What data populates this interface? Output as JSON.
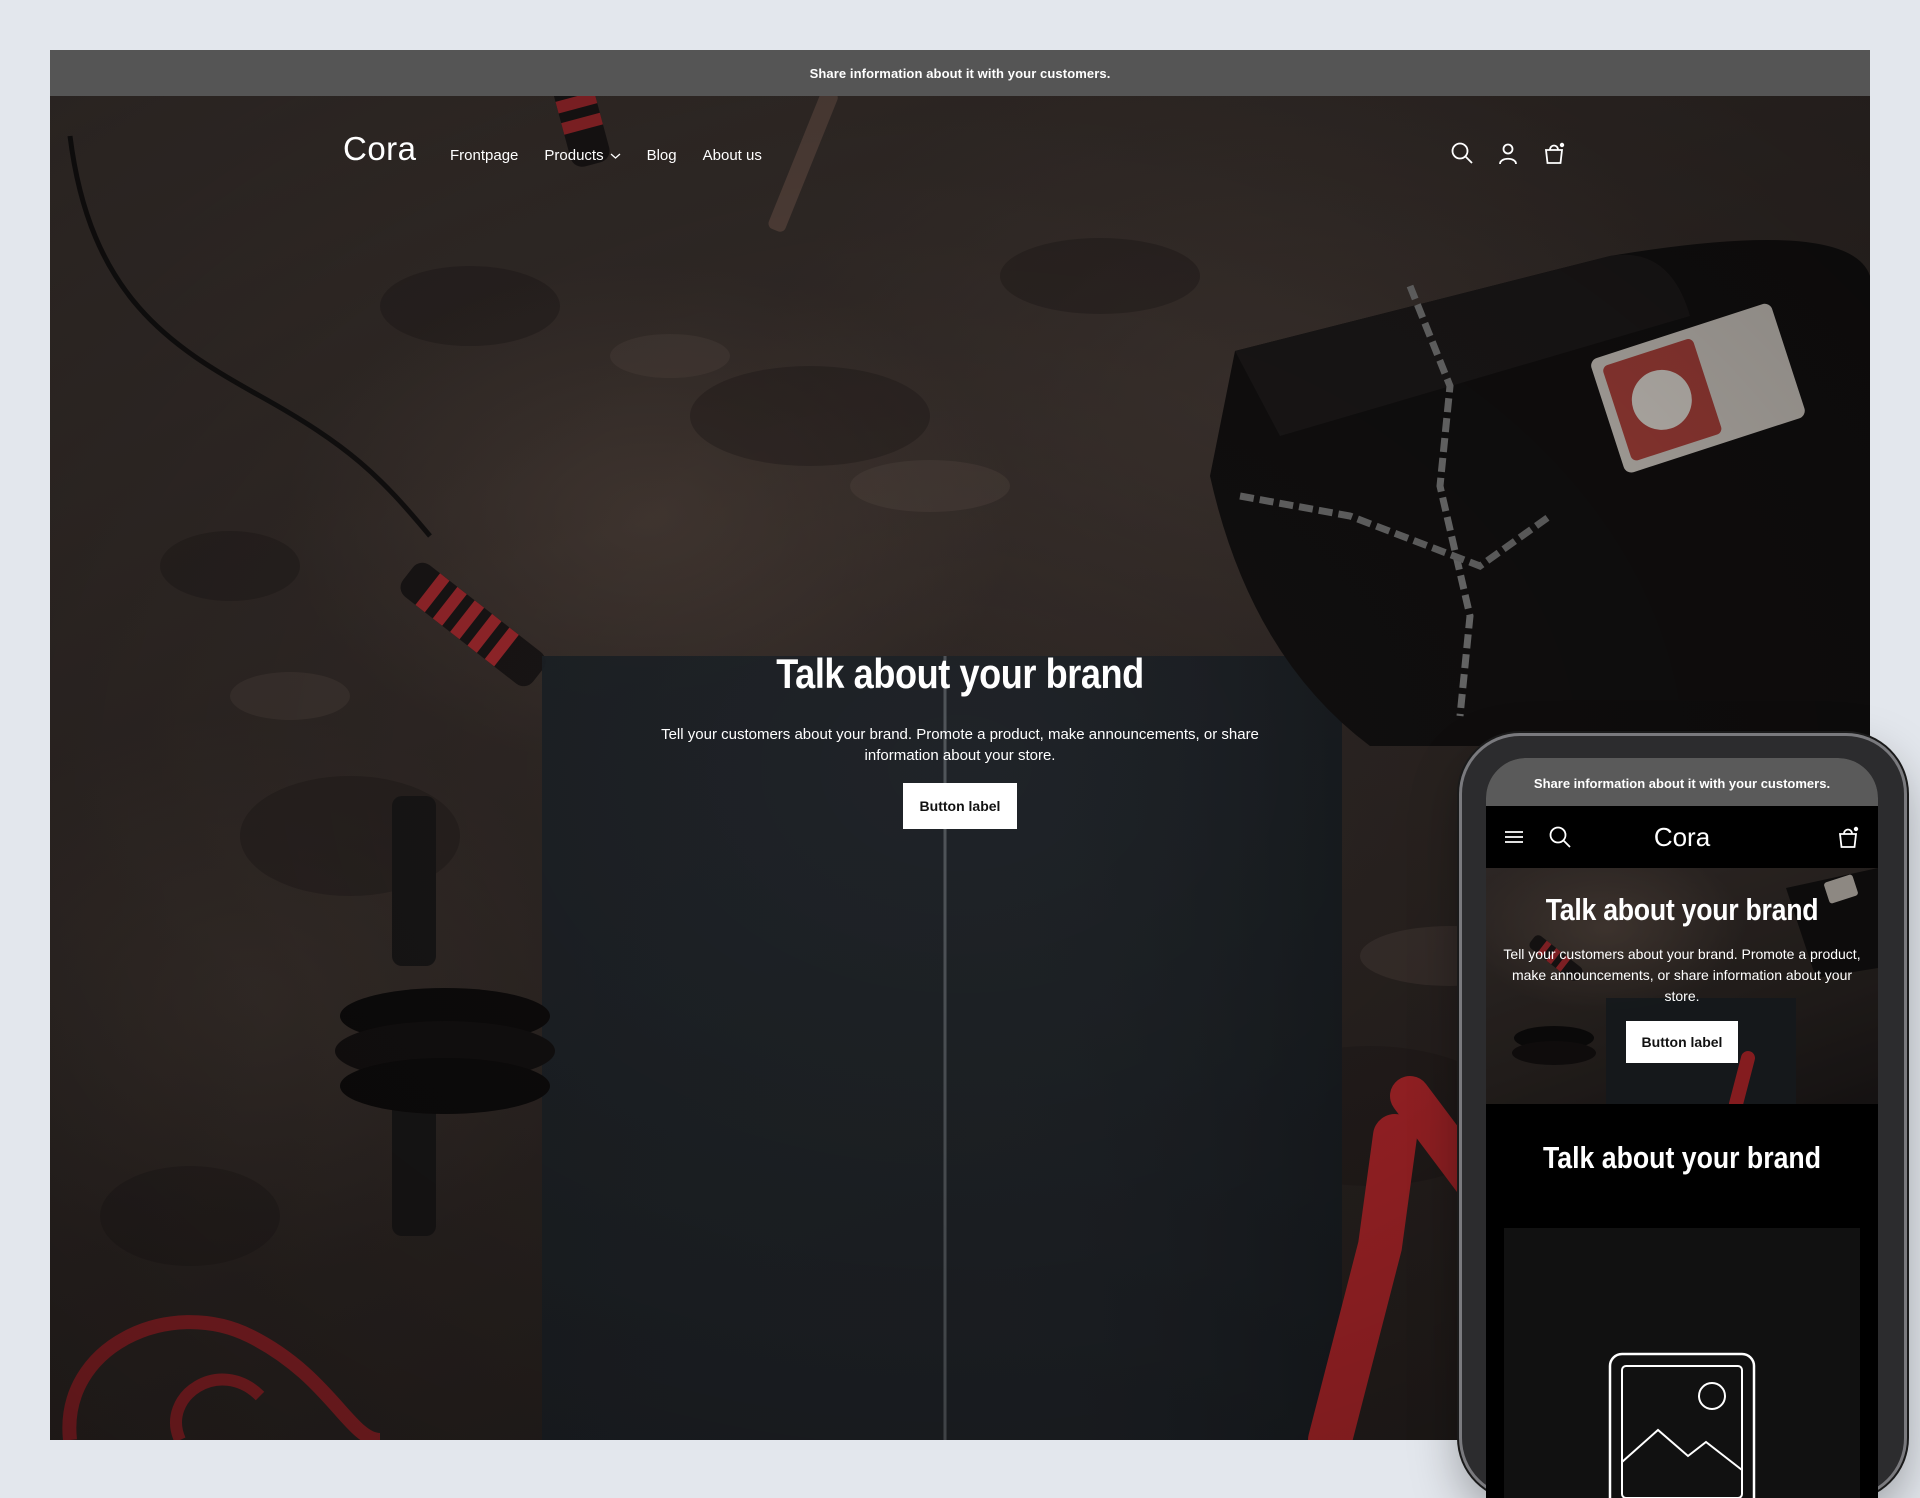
{
  "desktop": {
    "announcement": "Share information about it with your customers.",
    "logo": "Cora",
    "nav": [
      {
        "label": "Frontpage"
      },
      {
        "label": "Products"
      },
      {
        "label": "Blog"
      },
      {
        "label": "About us"
      }
    ],
    "icons": [
      "search-icon",
      "account-icon",
      "cart-icon"
    ],
    "hero": {
      "title": "Talk about your brand",
      "text": "Tell your customers about your brand. Promote a product, make announcements, or share information about your store.",
      "button": "Button label"
    }
  },
  "mobile": {
    "announcement": "Share information about it with your customers.",
    "logo": "Cora",
    "icons": [
      "menu-icon",
      "search-icon",
      "cart-icon"
    ],
    "hero": {
      "title": "Talk about your brand",
      "text": "Tell your customers about your brand. Promote a product, make announcements, or share information about your store.",
      "button": "Button label"
    },
    "section_title": "Talk about your brand",
    "image_placeholder_icon": "image-placeholder-icon"
  },
  "colors": {
    "announcement_bg": "#555555",
    "page_bg": "#e3e7ed",
    "accent_red": "#b3262b",
    "button_bg": "#ffffff"
  }
}
